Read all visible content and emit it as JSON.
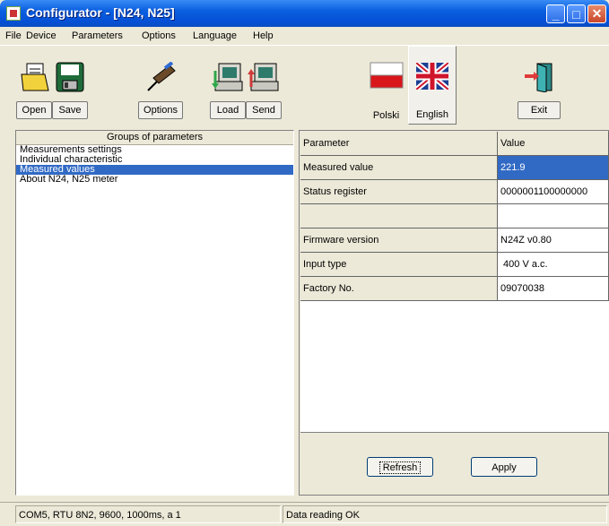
{
  "window": {
    "title": "Configurator - [N24, N25]"
  },
  "menu": [
    "File",
    "Device",
    "Parameters",
    "Options",
    "Language",
    "Help"
  ],
  "toolbar": {
    "open": "Open",
    "save": "Save",
    "options": "Options",
    "load": "Load",
    "send": "Send",
    "polski": "Polski",
    "english": "English",
    "exit": "Exit"
  },
  "groups": {
    "header": "Groups of parameters",
    "items": [
      {
        "label": "Measurements settings"
      },
      {
        "label": "Individual characteristic"
      },
      {
        "label": "Measured values",
        "selected": true
      },
      {
        "label": "About N24, N25 meter"
      }
    ]
  },
  "params": {
    "header_param": "Parameter",
    "header_value": "Value",
    "rows": [
      {
        "param": "Measured value",
        "value": "221.9",
        "selected": true
      },
      {
        "param": "Status register",
        "value": "0000001100000000"
      },
      {
        "param": "",
        "value": ""
      },
      {
        "param": "Firmware version",
        "value": "N24Z v0.80"
      },
      {
        "param": "Input type",
        "value": " 400 V a.c."
      },
      {
        "param": "Factory No.",
        "value": "09070038"
      }
    ]
  },
  "buttons": {
    "refresh": "Refresh",
    "apply": "Apply"
  },
  "status": {
    "connection": "COM5, RTU 8N2, 9600, 1000ms, a 1",
    "message": "Data reading OK"
  },
  "colors": {
    "titlebar": "#0A5FE0",
    "selection": "#316AC5",
    "face": "#ECE9D8"
  }
}
